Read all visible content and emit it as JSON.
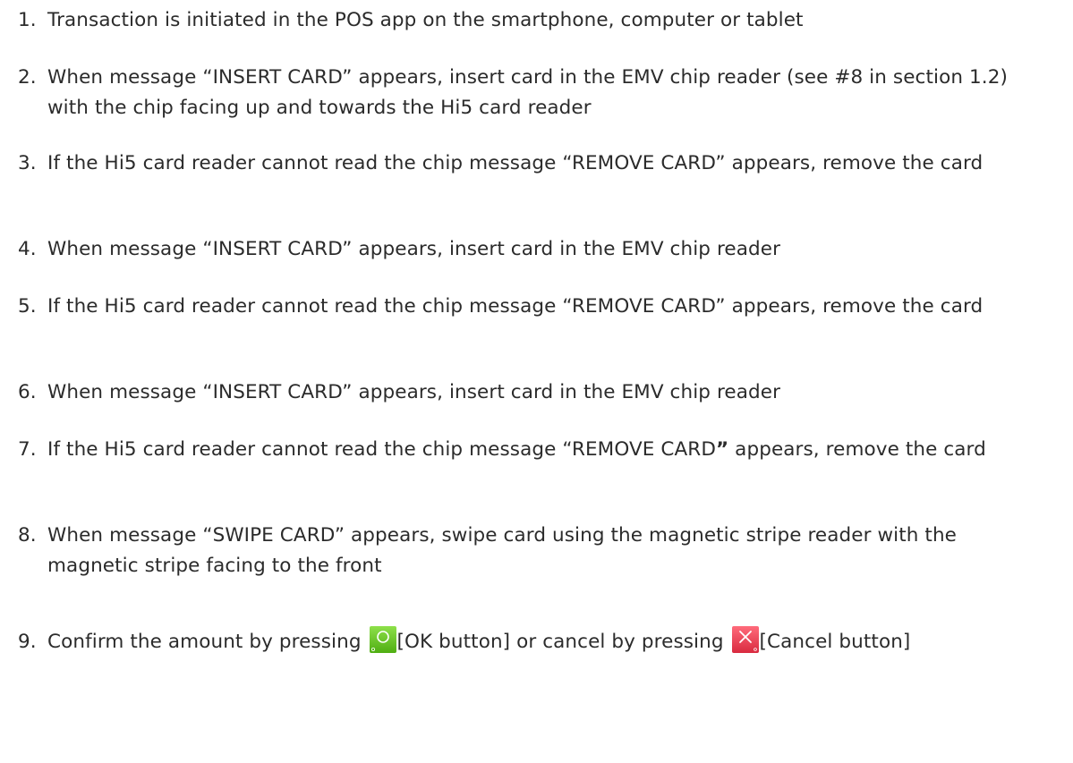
{
  "steps": [
    {
      "num": "1.",
      "text": "Transaction is initiated in the POS app on the smartphone, computer or tablet"
    },
    {
      "num": "2.",
      "text": "When message “INSERT CARD” appears, insert card in the EMV chip reader (see #8 in section 1.2) with the chip facing up and towards the Hi5 card reader"
    },
    {
      "num": "3.",
      "text": "If the Hi5 card reader cannot read the chip message “REMOVE CARD” appears, remove the card"
    },
    {
      "num": "4.",
      "text": "When message “INSERT CARD” appears, insert card in the EMV chip reader"
    },
    {
      "num": "5.",
      "text": "If the Hi5 card reader cannot read the chip message “REMOVE CARD” appears, remove the card"
    },
    {
      "num": "6.",
      "text": "When message “INSERT CARD” appears, insert card in the EMV chip reader"
    },
    {
      "num": "7.",
      "text_before": "If the Hi5 card reader cannot read the chip message “REMOVE CARD",
      "text_bold": "”",
      "text_after": " appears, remove the card"
    },
    {
      "num": "8.",
      "text": "When message “SWIPE CARD” appears, swipe card using the magnetic stripe reader with the magnetic stripe facing to the front"
    },
    {
      "num": "9.",
      "text_a": "Confirm the amount by pressing ",
      "text_b": "[OK button] or cancel by pressing ",
      "text_c": "[Cancel button]"
    }
  ],
  "icons": {
    "ok": {
      "name": "ok-button-icon",
      "color": "#66c419"
    },
    "cancel": {
      "name": "cancel-button-icon",
      "color": "#e83a4e"
    }
  }
}
